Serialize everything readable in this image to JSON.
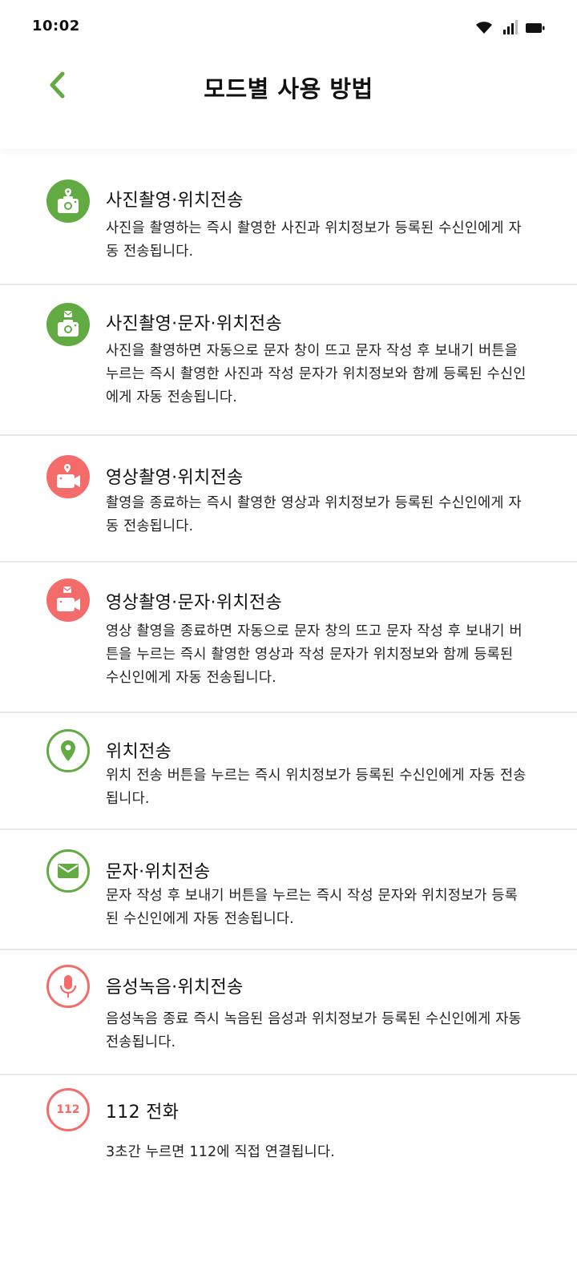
{
  "status_bar": {
    "time": "10:02"
  },
  "header": {
    "title": "모드별 사용 방법"
  },
  "colors": {
    "accent_green": "#62ab43",
    "accent_red": "#f36c6a"
  },
  "modes": [
    {
      "icon": "camera-location-icon",
      "title": "사진촬영·위치전송",
      "description": "사진을 촬영하는 즉시 촬영한 사진과 위치정보가 등록된 수신인에게 자동 전송됩니다."
    },
    {
      "icon": "camera-message-icon",
      "title": "사진촬영·문자·위치전송",
      "description": "사진을 촬영하면 자동으로 문자 창이 뜨고 문자 작성 후 보내기 버튼을 누르는 즉시 촬영한 사진과 작성 문자가 위치정보와 함께 등록된 수신인에게 자동 전송됩니다."
    },
    {
      "icon": "video-location-icon",
      "title": "영상촬영·위치전송",
      "description": "촬영을 종료하는 즉시 촬영한 영상과 위치정보가 등록된 수신인에게 자동 전송됩니다."
    },
    {
      "icon": "video-message-icon",
      "title": "영상촬영·문자·위치전송",
      "description": "영상 촬영을 종료하면 자동으로 문자 창의 뜨고 문자 작성 후 보내기 버튼을 누르는 즉시 촬영한 영상과 작성 문자가 위치정보와 함께 등록된 수신인에게 자동 전송됩니다."
    },
    {
      "icon": "location-pin-icon",
      "title": "위치전송",
      "description": "위치 전송 버튼을 누르는 즉시 위치정보가 등록된 수신인에게 자동 전송됩니다."
    },
    {
      "icon": "envelope-icon",
      "title": "문자·위치전송",
      "description": "문자 작성 후 보내기 버튼을 누르는 즉시 작성 문자와 위치정보가 등록된 수신인에게 자동 전송됩니다."
    },
    {
      "icon": "microphone-icon",
      "title": "음성녹음·위치전송",
      "description": "음성녹음 종료 즉시 녹음된 음성과 위치정보가 등록된 수신인에게 자동 전송됩니다."
    },
    {
      "icon": "emergency-112-icon",
      "icon_text": "112",
      "title": "112 전화",
      "description": "3초간 누르면 112에 직접 연결됩니다."
    }
  ]
}
